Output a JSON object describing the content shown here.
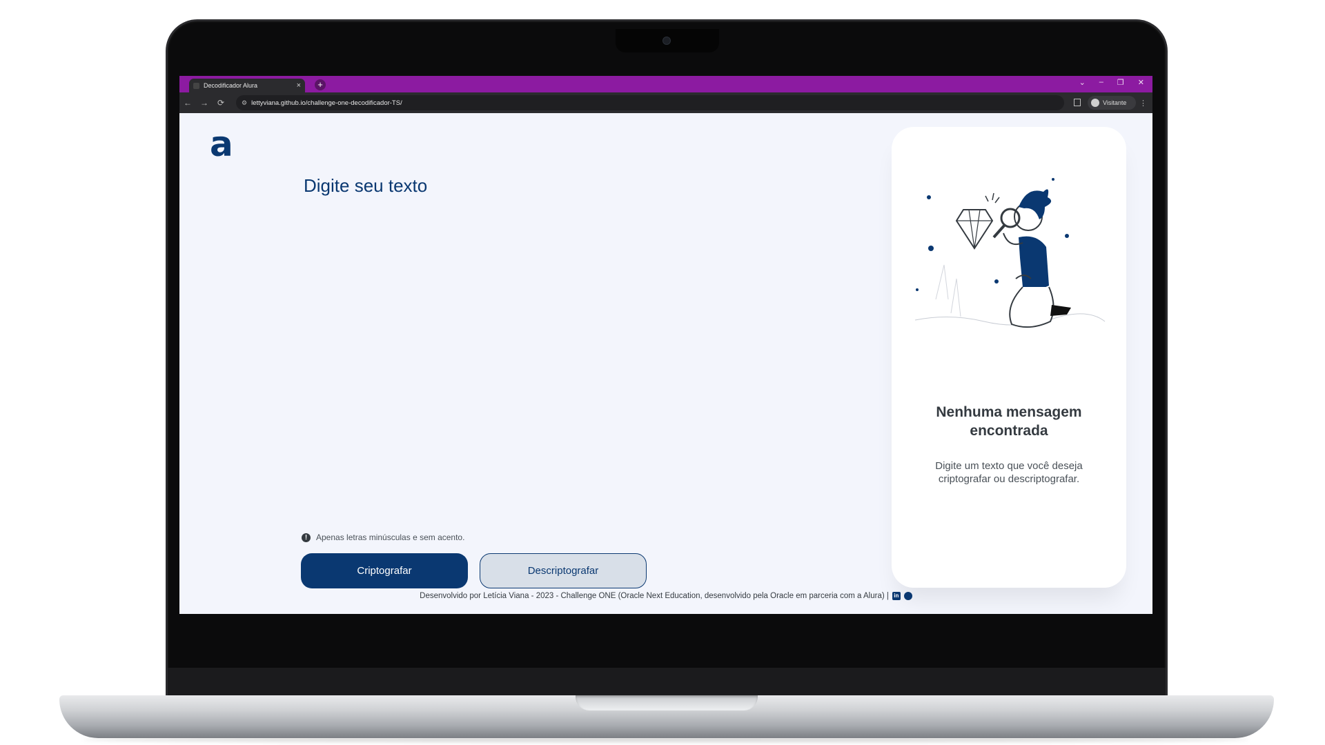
{
  "browser": {
    "tab_title": "Decodificador Alura",
    "tab_close": "×",
    "new_tab": "+",
    "url": "lettyviana.github.io/challenge-one-decodificador-TS/",
    "profile_label": "Visitante",
    "nav": {
      "back": "←",
      "forward": "→",
      "reload": "⟳"
    },
    "window_controls": {
      "chevron": "⌄",
      "minimize": "–",
      "restore": "❐",
      "close": "✕"
    },
    "tabbar_color": "#8c1ba1"
  },
  "page": {
    "logo": "a",
    "input_placeholder": "Digite seu texto",
    "hint": "Apenas letras minúsculas e sem acento.",
    "hint_icon": "!",
    "encrypt_button": "Criptografar",
    "decrypt_button": "Descriptografar",
    "footer": "Desenvolvido por Letícia Viana - 2023 - Challenge ONE (Oracle Next Education, desenvolvido pela Oracle em parceria com a Alura) |",
    "footer_linkedin": "in",
    "accent_color": "#0a3871"
  },
  "output_card": {
    "title": "Nenhuma mensagem encontrada",
    "description": "Digite um texto que você deseja criptografar ou descriptografar."
  }
}
